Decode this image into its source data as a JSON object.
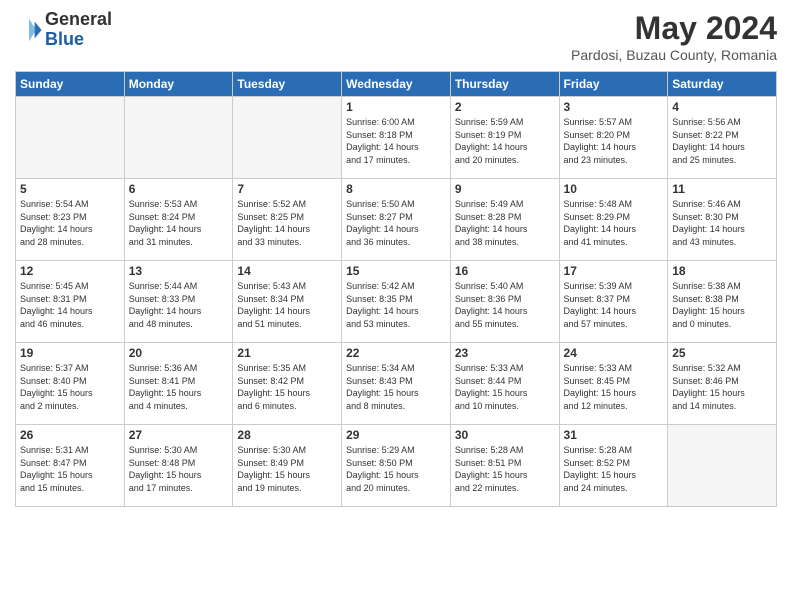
{
  "header": {
    "logo_general": "General",
    "logo_blue": "Blue",
    "month_title": "May 2024",
    "location": "Pardosi, Buzau County, Romania"
  },
  "days_of_week": [
    "Sunday",
    "Monday",
    "Tuesday",
    "Wednesday",
    "Thursday",
    "Friday",
    "Saturday"
  ],
  "weeks": [
    [
      {
        "num": "",
        "info": ""
      },
      {
        "num": "",
        "info": ""
      },
      {
        "num": "",
        "info": ""
      },
      {
        "num": "1",
        "info": "Sunrise: 6:00 AM\nSunset: 8:18 PM\nDaylight: 14 hours\nand 17 minutes."
      },
      {
        "num": "2",
        "info": "Sunrise: 5:59 AM\nSunset: 8:19 PM\nDaylight: 14 hours\nand 20 minutes."
      },
      {
        "num": "3",
        "info": "Sunrise: 5:57 AM\nSunset: 8:20 PM\nDaylight: 14 hours\nand 23 minutes."
      },
      {
        "num": "4",
        "info": "Sunrise: 5:56 AM\nSunset: 8:22 PM\nDaylight: 14 hours\nand 25 minutes."
      }
    ],
    [
      {
        "num": "5",
        "info": "Sunrise: 5:54 AM\nSunset: 8:23 PM\nDaylight: 14 hours\nand 28 minutes."
      },
      {
        "num": "6",
        "info": "Sunrise: 5:53 AM\nSunset: 8:24 PM\nDaylight: 14 hours\nand 31 minutes."
      },
      {
        "num": "7",
        "info": "Sunrise: 5:52 AM\nSunset: 8:25 PM\nDaylight: 14 hours\nand 33 minutes."
      },
      {
        "num": "8",
        "info": "Sunrise: 5:50 AM\nSunset: 8:27 PM\nDaylight: 14 hours\nand 36 minutes."
      },
      {
        "num": "9",
        "info": "Sunrise: 5:49 AM\nSunset: 8:28 PM\nDaylight: 14 hours\nand 38 minutes."
      },
      {
        "num": "10",
        "info": "Sunrise: 5:48 AM\nSunset: 8:29 PM\nDaylight: 14 hours\nand 41 minutes."
      },
      {
        "num": "11",
        "info": "Sunrise: 5:46 AM\nSunset: 8:30 PM\nDaylight: 14 hours\nand 43 minutes."
      }
    ],
    [
      {
        "num": "12",
        "info": "Sunrise: 5:45 AM\nSunset: 8:31 PM\nDaylight: 14 hours\nand 46 minutes."
      },
      {
        "num": "13",
        "info": "Sunrise: 5:44 AM\nSunset: 8:33 PM\nDaylight: 14 hours\nand 48 minutes."
      },
      {
        "num": "14",
        "info": "Sunrise: 5:43 AM\nSunset: 8:34 PM\nDaylight: 14 hours\nand 51 minutes."
      },
      {
        "num": "15",
        "info": "Sunrise: 5:42 AM\nSunset: 8:35 PM\nDaylight: 14 hours\nand 53 minutes."
      },
      {
        "num": "16",
        "info": "Sunrise: 5:40 AM\nSunset: 8:36 PM\nDaylight: 14 hours\nand 55 minutes."
      },
      {
        "num": "17",
        "info": "Sunrise: 5:39 AM\nSunset: 8:37 PM\nDaylight: 14 hours\nand 57 minutes."
      },
      {
        "num": "18",
        "info": "Sunrise: 5:38 AM\nSunset: 8:38 PM\nDaylight: 15 hours\nand 0 minutes."
      }
    ],
    [
      {
        "num": "19",
        "info": "Sunrise: 5:37 AM\nSunset: 8:40 PM\nDaylight: 15 hours\nand 2 minutes."
      },
      {
        "num": "20",
        "info": "Sunrise: 5:36 AM\nSunset: 8:41 PM\nDaylight: 15 hours\nand 4 minutes."
      },
      {
        "num": "21",
        "info": "Sunrise: 5:35 AM\nSunset: 8:42 PM\nDaylight: 15 hours\nand 6 minutes."
      },
      {
        "num": "22",
        "info": "Sunrise: 5:34 AM\nSunset: 8:43 PM\nDaylight: 15 hours\nand 8 minutes."
      },
      {
        "num": "23",
        "info": "Sunrise: 5:33 AM\nSunset: 8:44 PM\nDaylight: 15 hours\nand 10 minutes."
      },
      {
        "num": "24",
        "info": "Sunrise: 5:33 AM\nSunset: 8:45 PM\nDaylight: 15 hours\nand 12 minutes."
      },
      {
        "num": "25",
        "info": "Sunrise: 5:32 AM\nSunset: 8:46 PM\nDaylight: 15 hours\nand 14 minutes."
      }
    ],
    [
      {
        "num": "26",
        "info": "Sunrise: 5:31 AM\nSunset: 8:47 PM\nDaylight: 15 hours\nand 15 minutes."
      },
      {
        "num": "27",
        "info": "Sunrise: 5:30 AM\nSunset: 8:48 PM\nDaylight: 15 hours\nand 17 minutes."
      },
      {
        "num": "28",
        "info": "Sunrise: 5:30 AM\nSunset: 8:49 PM\nDaylight: 15 hours\nand 19 minutes."
      },
      {
        "num": "29",
        "info": "Sunrise: 5:29 AM\nSunset: 8:50 PM\nDaylight: 15 hours\nand 20 minutes."
      },
      {
        "num": "30",
        "info": "Sunrise: 5:28 AM\nSunset: 8:51 PM\nDaylight: 15 hours\nand 22 minutes."
      },
      {
        "num": "31",
        "info": "Sunrise: 5:28 AM\nSunset: 8:52 PM\nDaylight: 15 hours\nand 24 minutes."
      },
      {
        "num": "",
        "info": ""
      }
    ]
  ]
}
